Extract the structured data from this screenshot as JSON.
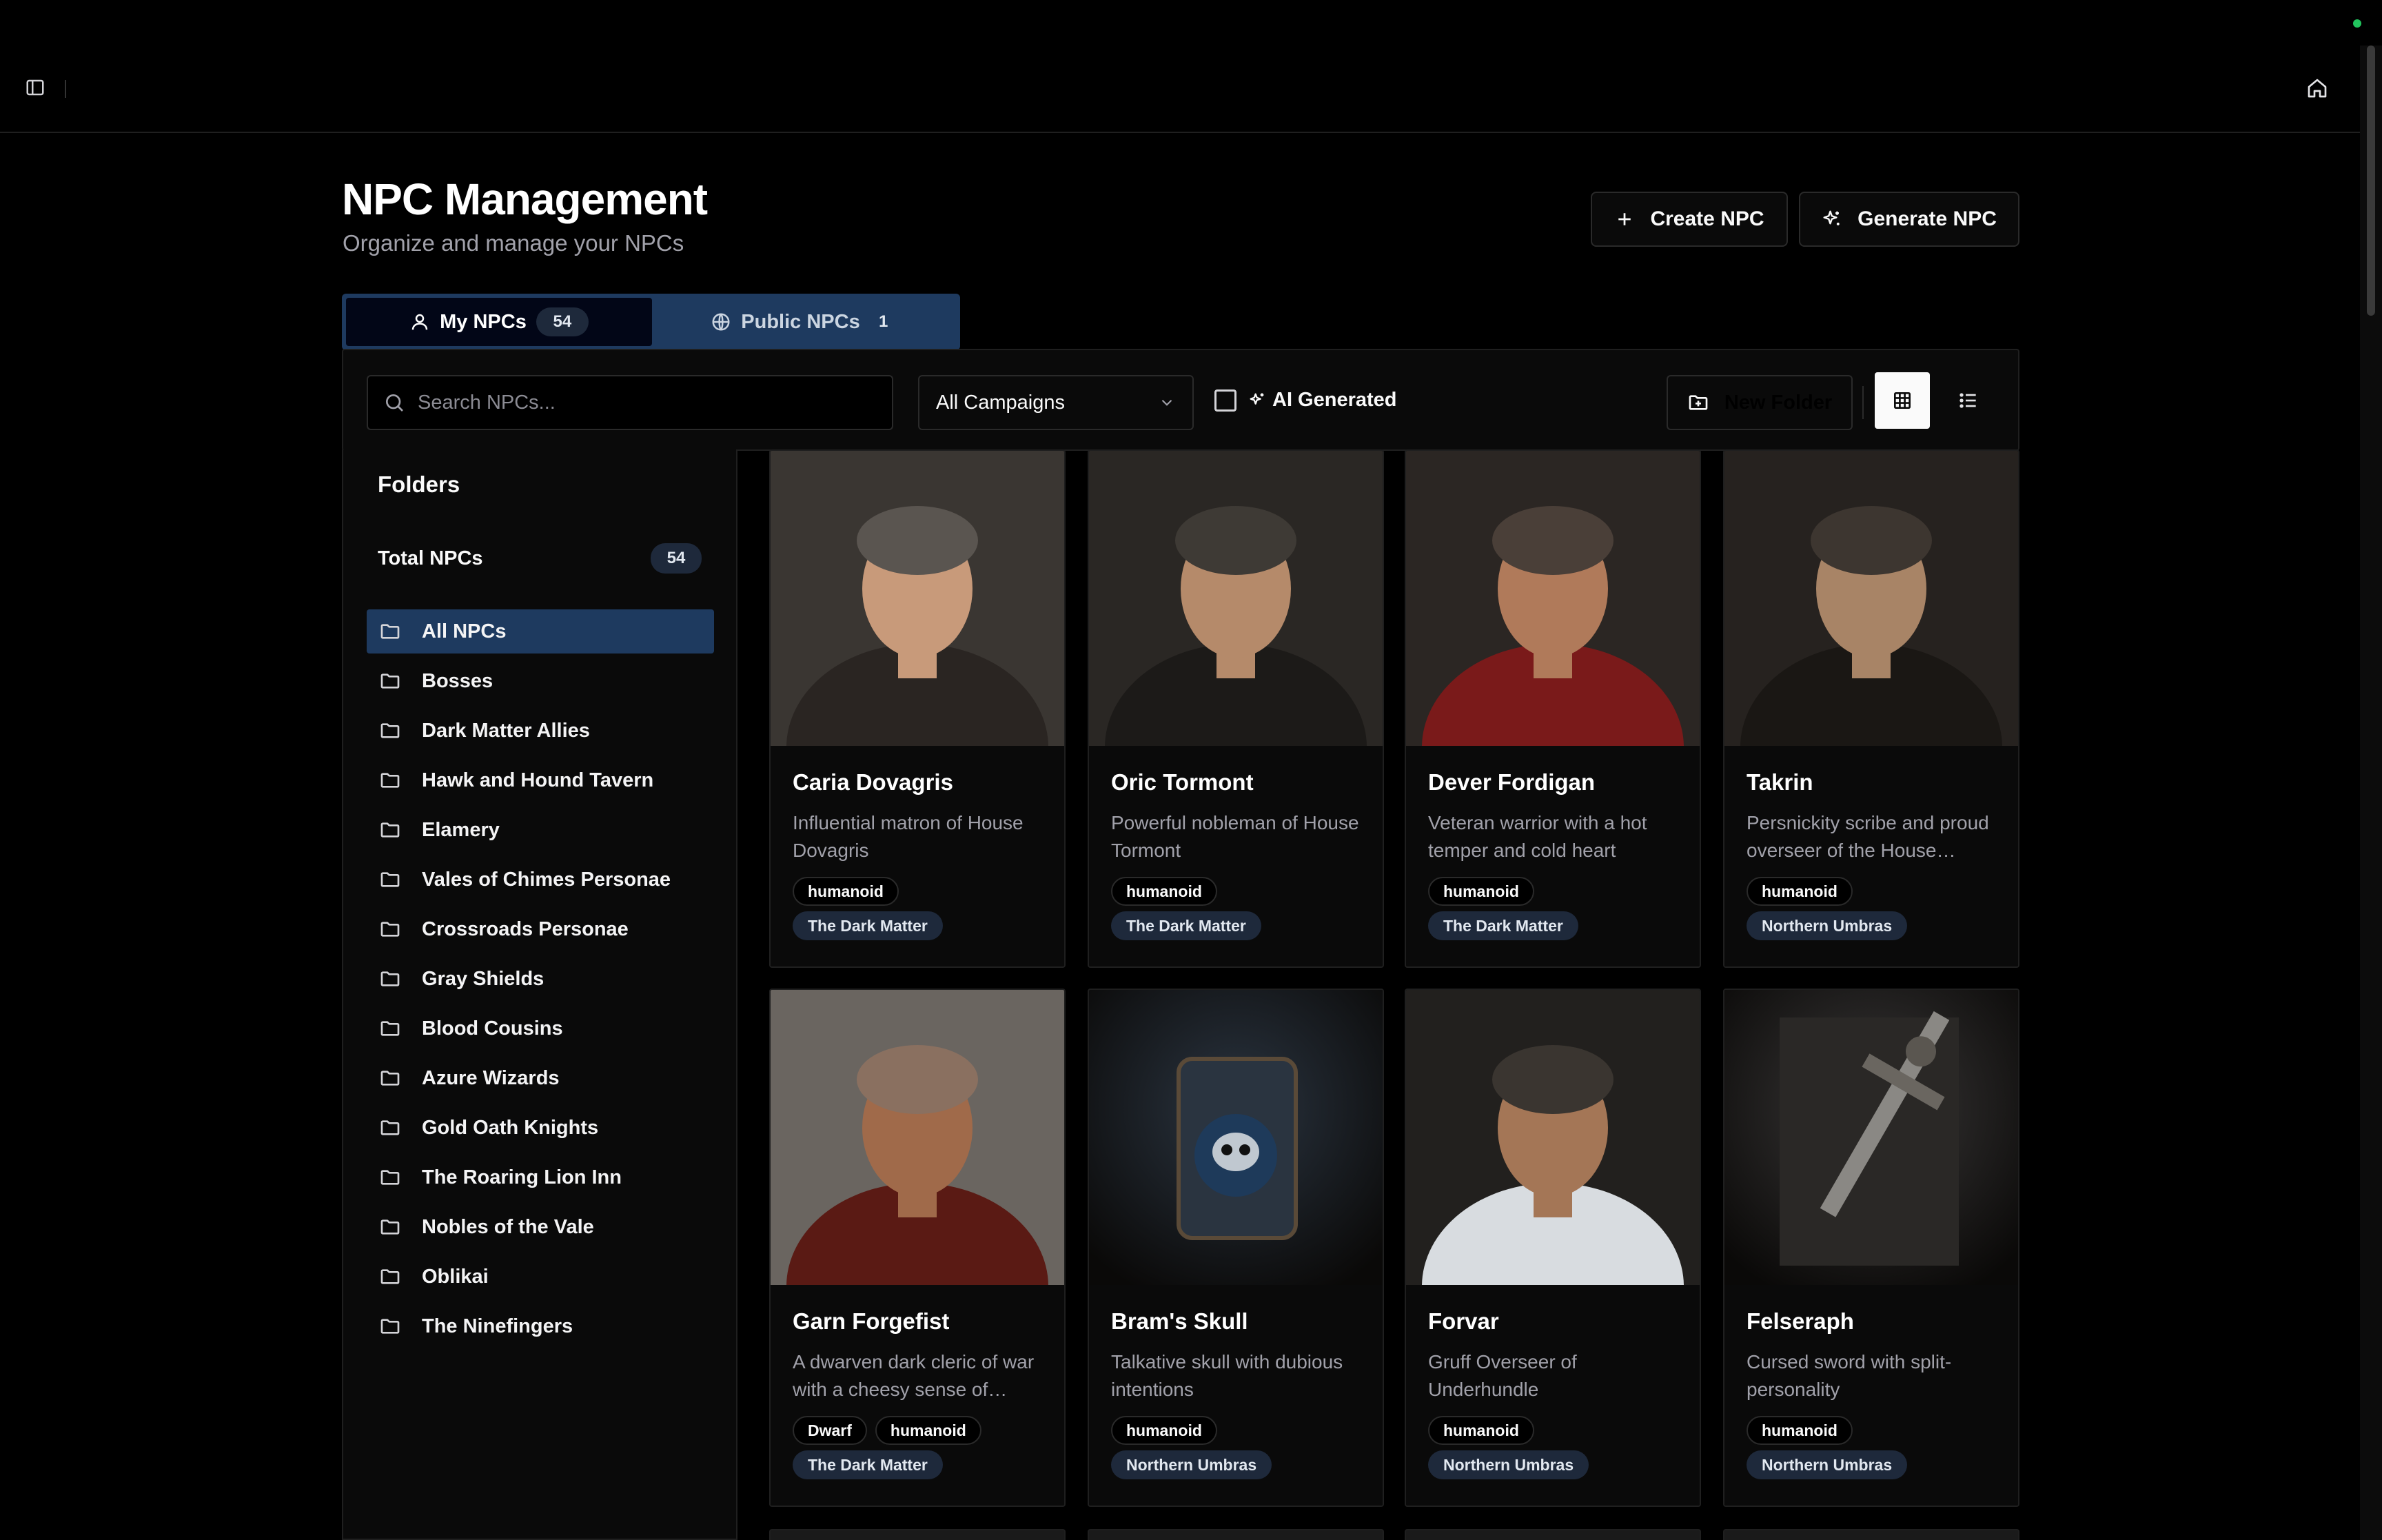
{
  "header": {
    "title": "NPC Management",
    "subtitle": "Organize and manage your NPCs",
    "create_label": "Create NPC",
    "generate_label": "Generate NPC"
  },
  "tabs": [
    {
      "label": "My NPCs",
      "count": "54",
      "icon": "user-icon"
    },
    {
      "label": "Public NPCs",
      "count": "1",
      "icon": "globe-icon"
    }
  ],
  "toolbar": {
    "search_placeholder": "Search NPCs...",
    "campaign_select": "All Campaigns",
    "ai_generated_label": "AI Generated",
    "new_folder_label": "New Folder"
  },
  "folders": {
    "title": "Folders",
    "total_label": "Total NPCs",
    "total_count": "54",
    "items": [
      {
        "label": "All NPCs"
      },
      {
        "label": "Bosses"
      },
      {
        "label": "Dark Matter Allies"
      },
      {
        "label": "Hawk and Hound Tavern"
      },
      {
        "label": "Elamery"
      },
      {
        "label": "Vales of Chimes Personae"
      },
      {
        "label": "Crossroads Personae"
      },
      {
        "label": "Gray Shields"
      },
      {
        "label": "Blood Cousins"
      },
      {
        "label": "Azure Wizards"
      },
      {
        "label": "Gold Oath Knights"
      },
      {
        "label": "The Roaring Lion Inn"
      },
      {
        "label": "Nobles of the Vale"
      },
      {
        "label": "Oblikai"
      },
      {
        "label": "The Ninefingers"
      }
    ]
  },
  "npcs": [
    {
      "name": "Caria Dovagris",
      "description": "Influential matron of House Dovagris",
      "tags": [
        "humanoid"
      ],
      "campaign": "The Dark Matter"
    },
    {
      "name": "Oric Tormont",
      "description": "Powerful nobleman of House Tormont",
      "tags": [
        "humanoid"
      ],
      "campaign": "The Dark Matter"
    },
    {
      "name": "Dever Fordigan",
      "description": "Veteran warrior with a hot temper and cold heart",
      "tags": [
        "humanoid"
      ],
      "campaign": "The Dark Matter"
    },
    {
      "name": "Takrin",
      "description": "Persnickity scribe and proud overseer of the House archives",
      "tags": [
        "humanoid"
      ],
      "campaign": "Northern Umbras"
    },
    {
      "name": "Garn Forgefist",
      "description": "A dwarven dark cleric of war with a cheesy sense of humor",
      "tags": [
        "Dwarf",
        "humanoid"
      ],
      "campaign": "The Dark Matter"
    },
    {
      "name": "Bram's Skull",
      "description": "Talkative skull with dubious intentions",
      "tags": [
        "humanoid"
      ],
      "campaign": "Northern Umbras"
    },
    {
      "name": "Forvar",
      "description": "Gruff Overseer of Underhundle",
      "tags": [
        "humanoid"
      ],
      "campaign": "Northern Umbras"
    },
    {
      "name": "Felseraph",
      "description": "Cursed sword with split-personality",
      "tags": [
        "humanoid"
      ],
      "campaign": "Northern Umbras"
    }
  ],
  "colors": {
    "background": "#000000",
    "panel": "#0a0a0a",
    "accent_active": "#1e3a5f",
    "badge": "#1e293b",
    "status_online": "#22c55e"
  }
}
